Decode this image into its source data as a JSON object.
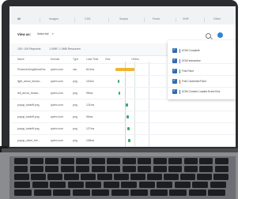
{
  "tabs": [
    "All",
    "Images",
    "CSS",
    "Scripts",
    "Fonts",
    "XHR",
    "Other"
  ],
  "toolbar": {
    "view_label": "View as:",
    "view_value": "Waterfall"
  },
  "summary": {
    "requests": "105 / 105 Requests",
    "size": "1.0MB / 1.0MB Resources"
  },
  "columns": [
    "Name",
    "Domain",
    "Type",
    "Load Time",
    "0ms",
    "100ms"
  ],
  "rows": [
    {
      "name": "ProductLiningAboutCss",
      "domain": "quirm.com",
      "type": "css",
      "time": "614ms"
    },
    {
      "name": "light_arrow_forwar...",
      "domain": "quirm.com",
      "type": "png",
      "time": "110ms"
    },
    {
      "name": "left_arrow_forwar...",
      "domain": "quirm.com",
      "type": "png",
      "time": "98ms"
    },
    {
      "name": "popup_tradeff.png",
      "domain": "quirm.com",
      "type": "png",
      "time": "121ms"
    },
    {
      "name": "popup_tradeff.png",
      "domain": "quirm.com",
      "type": "png",
      "time": "96ms"
    },
    {
      "name": "popup_tradeff.png",
      "domain": "quirm.com",
      "type": "png",
      "time": "127ms"
    },
    {
      "name": "popup_sliver_the...",
      "domain": "quirm.com",
      "type": "png",
      "time": "108ms"
    },
    {
      "name": "popup_sliver_the...",
      "domain": "quirm.com",
      "type": "png",
      "time": "107ms"
    }
  ],
  "legend": [
    {
      "label": "DOM Complete",
      "color": "#3b82c4"
    },
    {
      "label": "DOM Interactive",
      "color": "#8b5cf6"
    },
    {
      "label": "First Paint",
      "color": "#22a06b"
    },
    {
      "label": "First Contentful Paint",
      "color": "#e05a3a"
    },
    {
      "label": "DOM Content Loaded Event End",
      "color": "#3a7bd5"
    }
  ],
  "bar_colors": {
    "orange": "#f2b431",
    "green": "#3aa76d"
  }
}
